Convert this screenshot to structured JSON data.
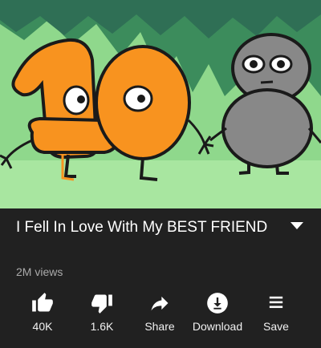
{
  "video": {
    "thumbnail_icons": [
      "number-one-character",
      "number-zero-character",
      "number-eight-character"
    ]
  },
  "metadata": {
    "title": "I Fell In Love With My BEST FRIEND",
    "views": "2M views"
  },
  "actions": [
    {
      "icon": "thumbs-up-icon",
      "label": "40K"
    },
    {
      "icon": "thumbs-down-icon",
      "label": "1.6K"
    },
    {
      "icon": "share-icon",
      "label": "Share"
    },
    {
      "icon": "download-icon",
      "label": "Download"
    },
    {
      "icon": "save-playlist-icon",
      "label": "Save"
    }
  ],
  "colors": {
    "background": "#212121",
    "text": "#ffffff",
    "secondary_text": "#aaaaaa",
    "orange_character": "#f8931f",
    "grass": "#8fd88c",
    "trees": "#3c8c5c"
  }
}
